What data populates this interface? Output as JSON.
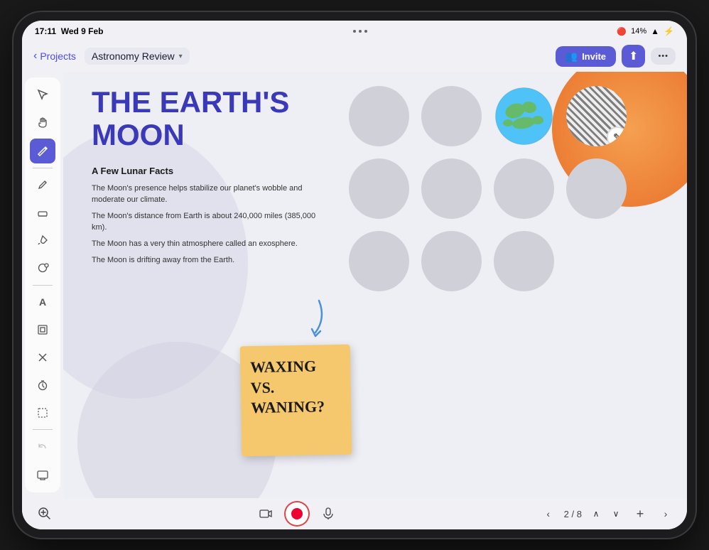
{
  "status_bar": {
    "time": "17:11",
    "date": "Wed 9 Feb",
    "dots": [
      "•",
      "•",
      "•"
    ],
    "battery": "14%",
    "wifi": "WiFi"
  },
  "nav": {
    "back_label": "Projects",
    "breadcrumb_label": "Astronomy Review",
    "invite_label": "Invite",
    "dots": "•••"
  },
  "toolbar": {
    "tools": [
      {
        "name": "cursor-tool",
        "icon": "⬚",
        "active": false
      },
      {
        "name": "hand-tool",
        "icon": "✋",
        "active": false
      },
      {
        "name": "pen-tool",
        "icon": "✏️",
        "active": true
      },
      {
        "name": "pencil-tool",
        "icon": "✒",
        "active": false
      },
      {
        "name": "eraser-tool",
        "icon": "◻",
        "active": false
      },
      {
        "name": "fill-tool",
        "icon": "⬟",
        "active": false
      },
      {
        "name": "shape-tool",
        "icon": "⬡",
        "active": false
      },
      {
        "name": "text-tool",
        "icon": "A",
        "active": false
      },
      {
        "name": "frame-tool",
        "icon": "▣",
        "active": false
      },
      {
        "name": "delete-tool",
        "icon": "✕",
        "active": false
      },
      {
        "name": "timer-tool",
        "icon": "⊕",
        "active": false
      },
      {
        "name": "select-tool",
        "icon": "⬚",
        "active": false
      },
      {
        "name": "undo-tool",
        "icon": "↩",
        "active": false,
        "disabled": true
      },
      {
        "name": "screen-tool",
        "icon": "▭",
        "active": false
      }
    ]
  },
  "slide": {
    "title_line1": "THE EARTH'S",
    "title_line2": "MOON",
    "subtitle": "A Few Lunar Facts",
    "facts": [
      "The Moon's presence helps stabilize our planet's wobble and moderate our climate.",
      "The Moon's distance from Earth is about 240,000 miles (385,000 km).",
      "The Moon has a very thin atmosphere called an exosphere.",
      "The Moon is drifting away from the Earth."
    ],
    "sticky_note": {
      "line1": "WAXING",
      "line2": "VS.",
      "line3": "WANING?"
    }
  },
  "bottom_bar": {
    "page_current": "2",
    "page_total": "8",
    "page_separator": "/",
    "add_label": "+",
    "zoom_icon": "zoom-icon",
    "mic_icon": "mic-icon",
    "camera_icon": "camera-icon"
  }
}
